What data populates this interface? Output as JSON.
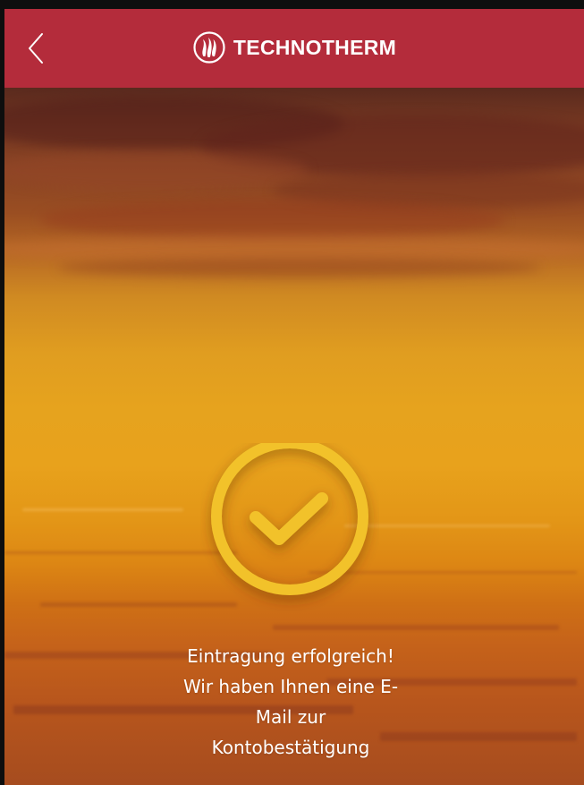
{
  "header": {
    "brand_name": "TECHNOTHERM",
    "logo_icon": "flame-logo-icon",
    "back_icon": "chevron-left-icon",
    "background_color": "#b42c3b"
  },
  "main": {
    "status_icon": "checkmark-circle-icon",
    "status_icon_color": "#f2c22c",
    "message": "Eintragung erfolgreich! Wir haben Ihnen eine E-Mail zur Kontobestätigung"
  }
}
